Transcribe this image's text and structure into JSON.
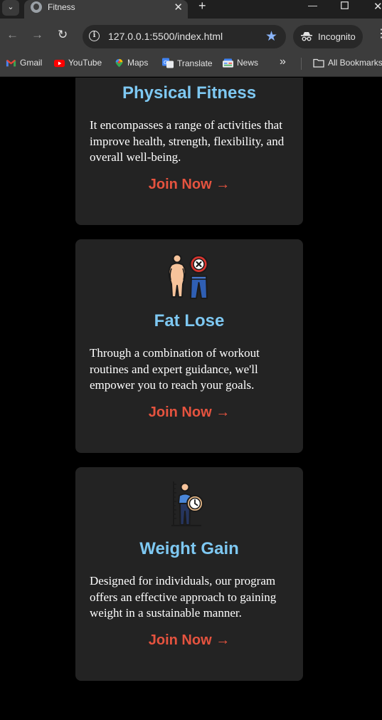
{
  "browser": {
    "tab_title": "Fitness",
    "url": "127.0.0.1:5500/index.html",
    "incognito_label": "Incognito",
    "bookmarks": [
      {
        "label": "Gmail",
        "icon": "gmail-icon"
      },
      {
        "label": "YouTube",
        "icon": "youtube-icon"
      },
      {
        "label": "Maps",
        "icon": "maps-icon"
      },
      {
        "label": "Translate",
        "icon": "translate-icon"
      },
      {
        "label": "News",
        "icon": "news-icon"
      }
    ],
    "bookmarks_overflow": "»",
    "all_bookmarks_label": "All Bookmarks"
  },
  "cards": [
    {
      "title": "Physical Fitness",
      "description": "It encompasses a range of activities that improve health, strength, flexibility, and overall well-being.",
      "cta": "Join Now →"
    },
    {
      "icon": "weight-loss-icon",
      "title": "Fat Lose",
      "description": "Through a combination of workout routines and expert guidance, we'll empower you to reach your goals.",
      "cta": "Join Now →"
    },
    {
      "icon": "weight-gain-icon",
      "title": "Weight Gain",
      "description": "Designed for individuals, our program offers an effective approach to gaining weight in a sustainable manner.",
      "cta": "Join Now →"
    }
  ],
  "colors": {
    "page_background": "#000000",
    "card_background": "#232323",
    "title_color": "#7ec8f2",
    "cta_color": "#e5533f"
  }
}
